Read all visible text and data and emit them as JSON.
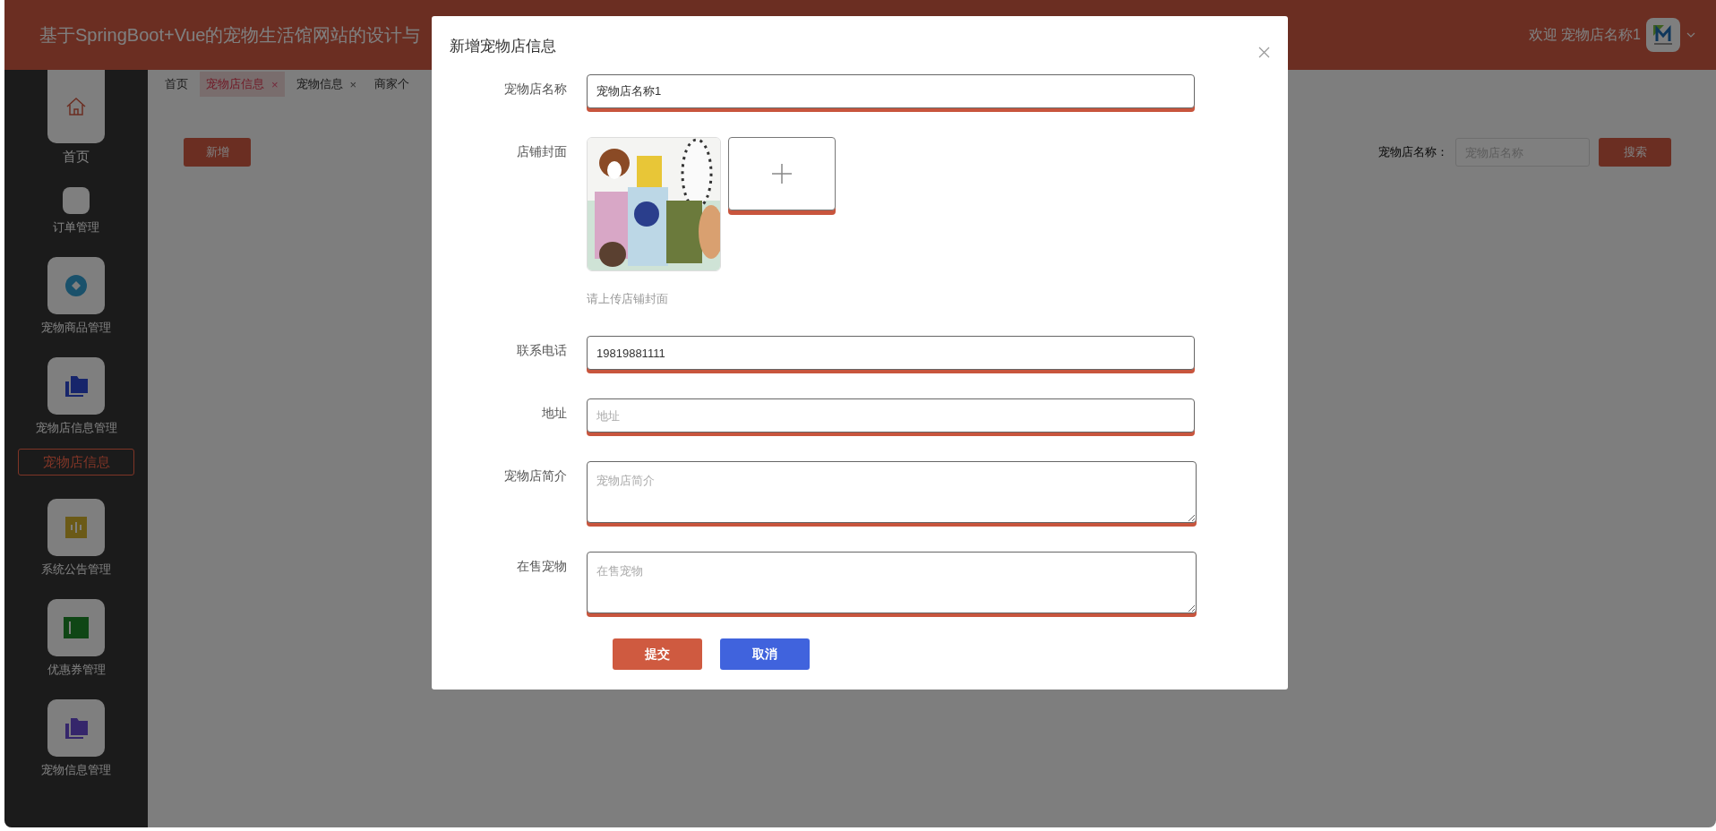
{
  "header": {
    "title": "基于SpringBoot+Vue的宠物生活馆网站的设计与",
    "welcome": "欢迎 宠物店名称1"
  },
  "sidebar": {
    "items": [
      {
        "label": "首页",
        "kind": "home",
        "selected": false
      },
      {
        "label": "订单管理",
        "kind": "blank",
        "selected": false
      },
      {
        "label": "宠物商品管理",
        "kind": "coin",
        "selected": false
      },
      {
        "label": "宠物店信息管理",
        "kind": "folder",
        "selected": false,
        "children": [
          {
            "label": "宠物店信息",
            "selected": true
          }
        ]
      },
      {
        "label": "系统公告管理",
        "kind": "notice",
        "selected": false
      },
      {
        "label": "优惠券管理",
        "kind": "coupon",
        "selected": false
      },
      {
        "label": "宠物信息管理",
        "kind": "folder2",
        "selected": false
      }
    ]
  },
  "tabs": [
    {
      "label": "首页",
      "selected": false
    },
    {
      "label": "宠物店信息",
      "close": "×",
      "selected": true
    },
    {
      "label": "宠物信息",
      "close": "×",
      "selected": false
    },
    {
      "label": "商家个",
      "selected": false
    }
  ],
  "toolbar": {
    "add_button": "新增",
    "search_label": "宠物店名称：",
    "search_placeholder": "宠物店名称",
    "search_button": "搜索"
  },
  "dialog": {
    "title": "新增宠物店信息",
    "fields": [
      {
        "kind": "text",
        "label": "宠物店名称",
        "value": "宠物店名称1"
      },
      {
        "kind": "upload",
        "label": "店铺封面",
        "hint": "请上传店铺封面"
      },
      {
        "kind": "text",
        "label": "联系电话",
        "value": "19819881111"
      },
      {
        "kind": "text",
        "label": "地址",
        "placeholder": "地址"
      },
      {
        "kind": "textarea",
        "label": "宠物店简介",
        "placeholder": "宠物店简介"
      },
      {
        "kind": "textarea",
        "label": "在售宠物",
        "placeholder": "在售宠物"
      }
    ],
    "buttons": [
      {
        "label": "提交",
        "kind": "primary"
      },
      {
        "label": "取消",
        "kind": "cancel"
      }
    ]
  }
}
